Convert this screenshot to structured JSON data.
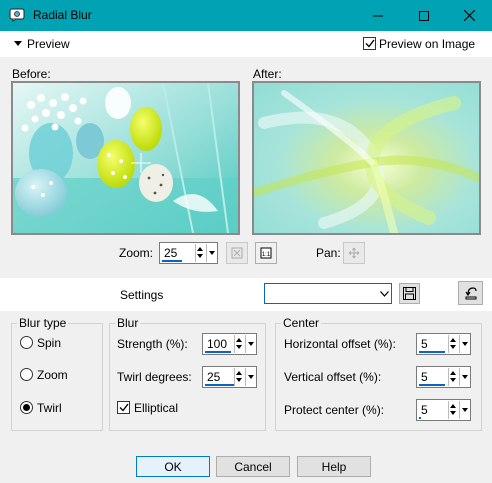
{
  "window": {
    "title": "Radial Blur",
    "icon": "radial-blur-app-icon",
    "controls": [
      "minimize-icon",
      "maximize-icon",
      "close-icon"
    ],
    "accent_color": "#00a2b4"
  },
  "preview": {
    "toggle_label": "Preview",
    "preview_on_image_label": "Preview on Image",
    "preview_on_image_checked": true,
    "before_label": "Before:",
    "after_label": "After:"
  },
  "zoom": {
    "label": "Zoom:",
    "value": "25",
    "pan_label": "Pan:"
  },
  "settings": {
    "label": "Settings",
    "value": ""
  },
  "blur_type": {
    "title": "Blur type",
    "options": [
      "Spin",
      "Zoom",
      "Twirl"
    ],
    "selected": "Twirl"
  },
  "blur": {
    "title": "Blur",
    "strength_label": "Strength (%):",
    "strength_value": "100",
    "twirl_label": "Twirl degrees:",
    "twirl_value": "25",
    "elliptical_label": "Elliptical",
    "elliptical_checked": true
  },
  "center": {
    "title": "Center",
    "horizontal_label": "Horizontal offset (%):",
    "horizontal_value": "5",
    "vertical_label": "Vertical offset (%):",
    "vertical_value": "5",
    "protect_label": "Protect center (%):",
    "protect_value": "5"
  },
  "buttons": {
    "ok": "OK",
    "cancel": "Cancel",
    "help": "Help"
  }
}
